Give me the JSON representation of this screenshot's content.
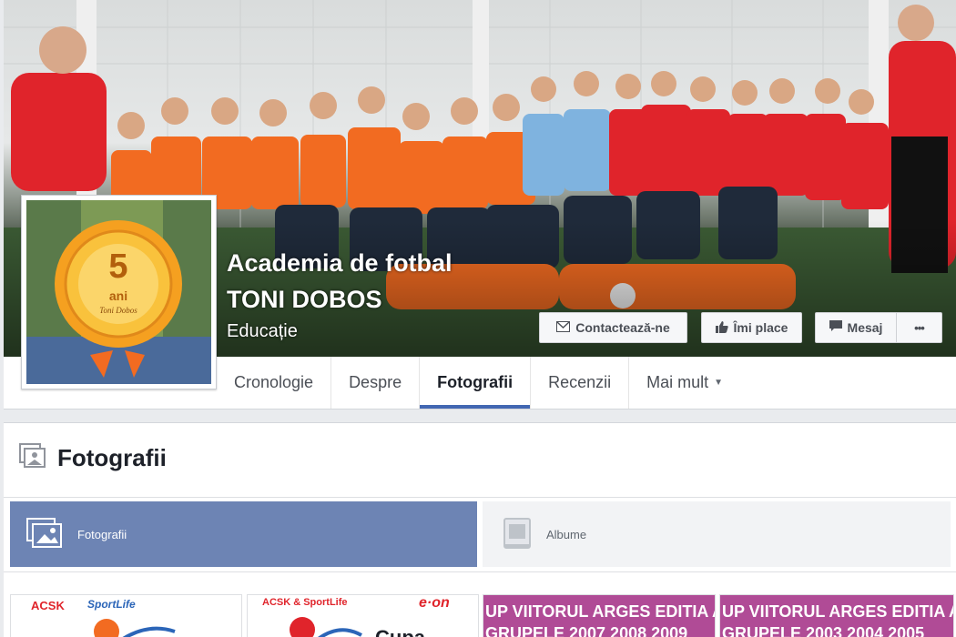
{
  "page": {
    "name_line1": "Academia de fotbal",
    "name_line2": "TONI DOBOS",
    "category": "Educație"
  },
  "cover_buttons": {
    "contact": "Contactează-ne",
    "like": "Îmi place",
    "message": "Mesaj",
    "more": "•••"
  },
  "profile_badge": {
    "years_number": "5",
    "years_word": "ani",
    "subtitle": "Toni Dobos"
  },
  "tabs": [
    {
      "label": "Cronologie",
      "active": false
    },
    {
      "label": "Despre",
      "active": false
    },
    {
      "label": "Fotografii",
      "active": true
    },
    {
      "label": "Recenzii",
      "active": false
    },
    {
      "label": "Mai mult",
      "active": false
    }
  ],
  "photos": {
    "title": "Fotografii",
    "subtabs": [
      {
        "label": "Fotografii",
        "selected": true
      },
      {
        "label": "Albume",
        "selected": false
      }
    ],
    "thumbnails": [
      {
        "line1": "ACSK",
        "line2": "SportLife"
      },
      {
        "line1": "ACSK & SportLife",
        "line2": "e·on",
        "line3": "Cupa"
      },
      {
        "line1": "UP VIITORUL ARGES EDITIA A-",
        "line2": "GRUPELE 2007 2008 2009"
      },
      {
        "line1": "UP VIITORUL ARGES EDITIA A-",
        "line2": "GRUPELE 2003 2004 2005"
      }
    ]
  },
  "colors": {
    "facebook_blue": "#4267b2",
    "subtab_selected": "#6d84b4",
    "thumb_purple": "#b04b96",
    "jersey_orange": "#f26b21",
    "jersey_red": "#e0242b"
  },
  "icons": {
    "contact": "envelope-icon",
    "like": "thumbs-up-icon",
    "message": "speech-bubble-icon",
    "photos_header": "photos-icon",
    "subtab_photos": "photo-stack-icon",
    "subtab_albums": "album-icon",
    "dropdown": "caret-down-icon"
  }
}
